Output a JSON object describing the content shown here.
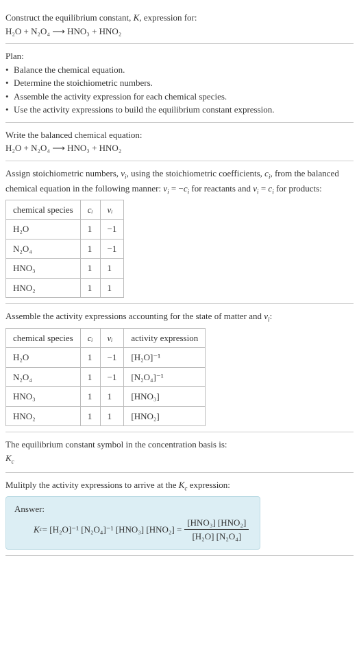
{
  "intro": {
    "line1": "Construct the equilibrium constant, ",
    "k": "K",
    "line1b": ", expression for:",
    "eq": "H₂O + N₂O₄ ⟶ HNO₃ + HNO₂"
  },
  "plan": {
    "title": "Plan:",
    "b1": "Balance the chemical equation.",
    "b2": "Determine the stoichiometric numbers.",
    "b3": "Assemble the activity expression for each chemical species.",
    "b4": "Use the activity expressions to build the equilibrium constant expression."
  },
  "balanced": {
    "title": "Write the balanced chemical equation:",
    "eq": "H₂O + N₂O₄ ⟶ HNO₃ + HNO₂"
  },
  "stoich": {
    "p1": "Assign stoichiometric numbers, ",
    "nu": "ν",
    "sub_i": "i",
    "p2": ", using the stoichiometric coefficients, ",
    "c": "c",
    "p3": ", from the balanced chemical equation in the following manner: ",
    "rel1a": "ν",
    "rel1b": " = −",
    "rel1c": "c",
    "p4": " for reactants and ",
    "rel2a": "ν",
    "rel2b": " = ",
    "rel2c": "c",
    "p5": " for products:",
    "h1": "chemical species",
    "h2": "cᵢ",
    "h3": "νᵢ",
    "r1": {
      "s": "H₂O",
      "c": "1",
      "v": "−1"
    },
    "r2": {
      "s": "N₂O₄",
      "c": "1",
      "v": "−1"
    },
    "r3": {
      "s": "HNO₃",
      "c": "1",
      "v": "1"
    },
    "r4": {
      "s": "HNO₂",
      "c": "1",
      "v": "1"
    }
  },
  "activity": {
    "p": "Assemble the activity expressions accounting for the state of matter and ",
    "nu": "ν",
    "sub_i": "i",
    "pend": ":",
    "h1": "chemical species",
    "h2": "cᵢ",
    "h3": "νᵢ",
    "h4": "activity expression",
    "r1": {
      "s": "H₂O",
      "c": "1",
      "v": "−1",
      "a": "[H₂O]⁻¹"
    },
    "r2": {
      "s": "N₂O₄",
      "c": "1",
      "v": "−1",
      "a": "[N₂O₄]⁻¹"
    },
    "r3": {
      "s": "HNO₃",
      "c": "1",
      "v": "1",
      "a": "[HNO₃]"
    },
    "r4": {
      "s": "HNO₂",
      "c": "1",
      "v": "1",
      "a": "[HNO₂]"
    }
  },
  "symbol": {
    "p": "The equilibrium constant symbol in the concentration basis is:",
    "k": "K",
    "kc": "c"
  },
  "final": {
    "p": "Mulitply the activity expressions to arrive at the ",
    "k": "K",
    "kc": "c",
    "pend": " expression:",
    "answer": "Answer:",
    "lhs_k": "K",
    "lhs_c": "c",
    "eq": " = [H₂O]⁻¹ [N₂O₄]⁻¹ [HNO₃] [HNO₂] = ",
    "num": "[HNO₃] [HNO₂]",
    "den": "[H₂O] [N₂O₄]"
  }
}
